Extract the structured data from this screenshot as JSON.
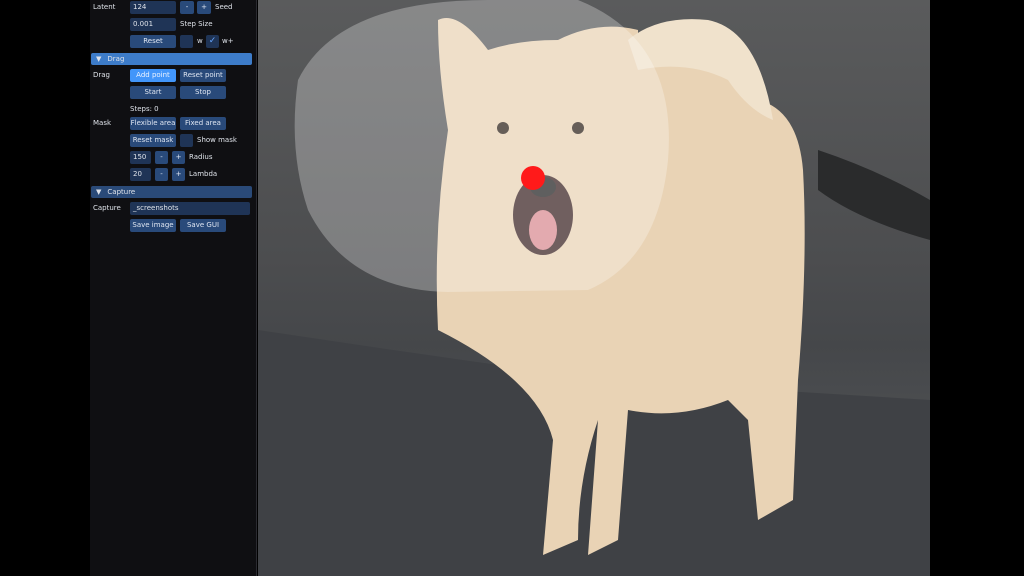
{
  "latent": {
    "label": "Latent",
    "seed_value": "124",
    "minus": "-",
    "plus": "+",
    "seed_label": "Seed",
    "step_value": "0.001",
    "step_label": "Step Size",
    "reset": "Reset",
    "w_label": "w",
    "wplus_label": "w+",
    "check": "✓"
  },
  "drag_section": {
    "header": "Drag",
    "label": "Drag",
    "add_point": "Add point",
    "reset_point": "Reset point",
    "start": "Start",
    "stop": "Stop",
    "steps": "Steps: 0"
  },
  "mask": {
    "label": "Mask",
    "flexible": "Flexible area",
    "fixed": "Fixed area",
    "reset_mask": "Reset mask",
    "show_mask": "Show mask",
    "radius_value": "150",
    "radius_label": "Radius",
    "lambda_value": "20",
    "lambda_label": "Lambda",
    "minus": "-",
    "plus": "+"
  },
  "capture": {
    "header": "Capture",
    "label": "Capture",
    "path": "_screenshots",
    "save_image": "Save image",
    "save_gui": "Save GUI"
  },
  "colors": {
    "handle_point": "#ff1a1a",
    "accent": "#4296fa"
  }
}
